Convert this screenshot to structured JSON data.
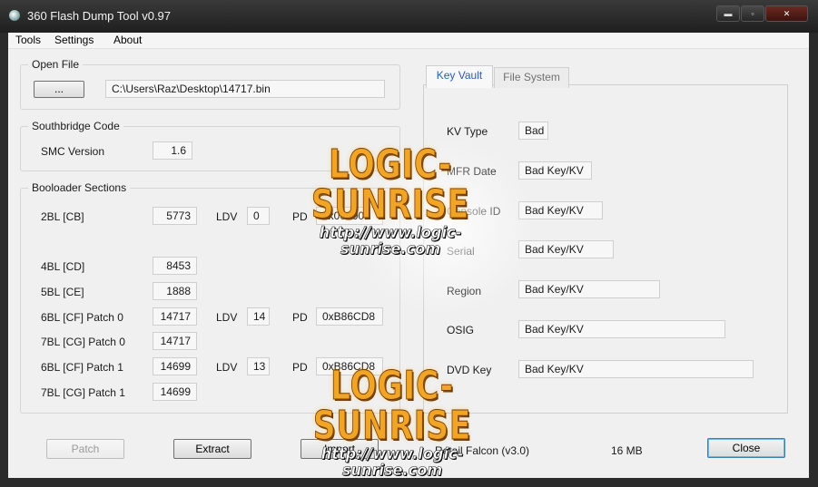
{
  "window": {
    "title": "360 Flash Dump Tool  v0.97",
    "minimize_glyph": "▬",
    "maximize_glyph": "▫",
    "close_glyph": "✕"
  },
  "menu": [
    "Tools",
    "Settings",
    "About"
  ],
  "open_file": {
    "group_title": "Open File",
    "browse_label": "...",
    "path": "C:\\Users\\Raz\\Desktop\\14717.bin"
  },
  "southbridge": {
    "group_title": "Southbridge Code",
    "smc_label": "SMC Version",
    "smc_value": "1.6"
  },
  "bootloader": {
    "group_title": "Booloader Sections",
    "ldv_label": "LDV",
    "pd_label": "PD",
    "rows": {
      "cb": {
        "label": "2BL [CB]",
        "value": "5773",
        "ldv": "0",
        "pd": "0x000000"
      },
      "cd": {
        "label": "4BL [CD]",
        "value": "8453"
      },
      "ce": {
        "label": "5BL [CE]",
        "value": "1888"
      },
      "cf0": {
        "label": "6BL [CF] Patch 0",
        "value": "14717",
        "ldv": "14",
        "pd": "0xB86CD8"
      },
      "cg0": {
        "label": "7BL [CG] Patch 0",
        "value": "14717"
      },
      "cf1": {
        "label": "6BL [CF] Patch 1",
        "value": "14699",
        "ldv": "13",
        "pd": "0xB86CD8"
      },
      "cg1": {
        "label": "7BL [CG] Patch 1",
        "value": "14699"
      }
    }
  },
  "tabs": {
    "key_vault": "Key Vault",
    "file_system": "File System"
  },
  "key_vault": {
    "kv_type": {
      "label": "KV Type",
      "value": "Bad"
    },
    "mfr_date": {
      "label": "MFR Date",
      "value": "Bad Key/KV"
    },
    "console_id": {
      "label": "Console ID",
      "value": "Bad Key/KV"
    },
    "serial": {
      "label": "Serial",
      "value": "Bad Key/KV"
    },
    "region": {
      "label": "Region",
      "value": "Bad Key/KV"
    },
    "osig": {
      "label": "OSIG",
      "value": "Bad Key/KV"
    },
    "dvd_key": {
      "label": "DVD Key",
      "value": "Bad Key/KV"
    }
  },
  "buttons": {
    "patch": "Patch",
    "extract": "Extract",
    "import": "Import",
    "close": "Close"
  },
  "status": {
    "console_type": "Retail Falcon (v3.0)",
    "flash_size": "16 MB"
  },
  "watermark": {
    "brand": "LOGIC-SUNRISE",
    "url": "http://www.logic-sunrise.com"
  }
}
